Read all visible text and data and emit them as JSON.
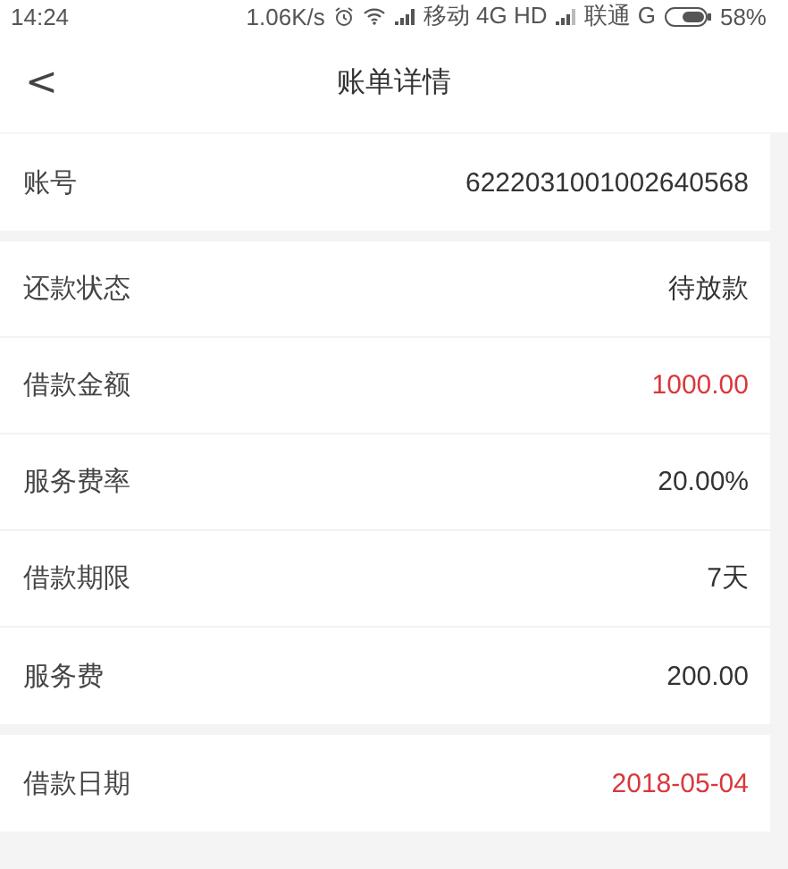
{
  "status_bar": {
    "time": "14:24",
    "speed": "1.06K/s",
    "carrier_1": "移动 4G HD",
    "carrier_2": "联通 G",
    "battery": "58%"
  },
  "header": {
    "back": "<",
    "title": "账单详情"
  },
  "sections": [
    {
      "rows": [
        {
          "label": "账号",
          "value": "6222031001002640568",
          "highlight": false
        }
      ]
    },
    {
      "rows": [
        {
          "label": "还款状态",
          "value": "待放款",
          "highlight": false
        },
        {
          "label": "借款金额",
          "value": "1000.00",
          "highlight": true
        },
        {
          "label": "服务费率",
          "value": "20.00%",
          "highlight": false
        },
        {
          "label": "借款期限",
          "value": "7天",
          "highlight": false
        },
        {
          "label": "服务费",
          "value": "200.00",
          "highlight": false
        }
      ]
    },
    {
      "rows": [
        {
          "label": "借款日期",
          "value": "2018-05-04",
          "highlight": true
        }
      ]
    }
  ]
}
